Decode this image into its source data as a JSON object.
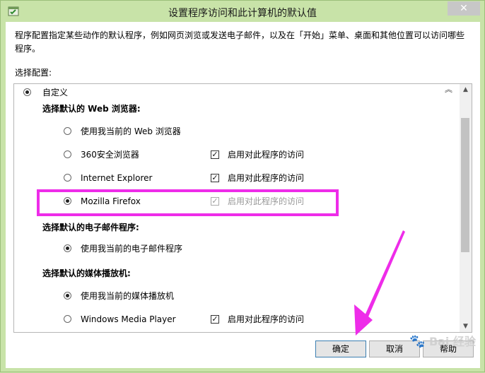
{
  "window": {
    "title": "设置程序访问和此计算机的默认值",
    "close_symbol": "✕"
  },
  "description": "程序配置指定某些动作的默认程序，例如网页浏览或发送电子邮件，以及在「开始」菜单、桌面和其他位置可以访问哪些程序。",
  "choose_label": "选择配置:",
  "config": {
    "option_label": "自定义",
    "selected": true,
    "sections": [
      {
        "heading": "选择默认的 Web 浏览器:",
        "items": [
          {
            "label": "使用我当前的 Web 浏览器",
            "selected": false,
            "has_access": false
          },
          {
            "label": "360安全浏览器",
            "selected": false,
            "has_access": true,
            "access_label": "启用对此程序的访问",
            "access_checked": true,
            "access_disabled": false
          },
          {
            "label": "Internet Explorer",
            "selected": false,
            "has_access": true,
            "access_label": "启用对此程序的访问",
            "access_checked": true,
            "access_disabled": false
          },
          {
            "label": "Mozilla Firefox",
            "selected": true,
            "has_access": true,
            "access_label": "启用对此程序的访问",
            "access_checked": true,
            "access_disabled": true
          }
        ]
      },
      {
        "heading": "选择默认的电子邮件程序:",
        "items": [
          {
            "label": "使用我当前的电子邮件程序",
            "selected": true,
            "has_access": false
          }
        ]
      },
      {
        "heading": "选择默认的媒体播放机:",
        "items": [
          {
            "label": "使用我当前的媒体播放机",
            "selected": true,
            "has_access": false
          },
          {
            "label": "Windows Media Player",
            "selected": false,
            "has_access": true,
            "access_label": "启用对此程序的访问",
            "access_checked": true,
            "access_disabled": false
          }
        ]
      }
    ]
  },
  "buttons": {
    "ok": "确定",
    "cancel": "取消",
    "help": "帮助"
  },
  "watermark": "Bai 经验",
  "annotation_colors": {
    "highlight": "#ee2ce9",
    "arrow": "#ee2ce9"
  }
}
